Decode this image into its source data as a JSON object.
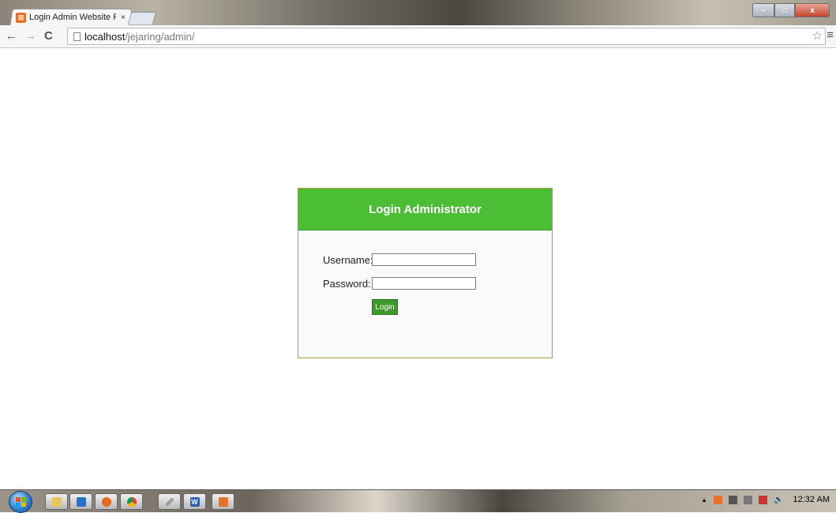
{
  "browser": {
    "tab_title": "Login Admin Website Pert",
    "tab_close": "×",
    "url_host": "localhost",
    "url_path": "/jejaring/admin/",
    "back_symbol": "←",
    "forward_symbol": "→",
    "reload_symbol": "C",
    "star_symbol": "☆",
    "menu_symbol": "≡",
    "win_min": "–",
    "win_max": "□",
    "win_close": "x"
  },
  "login": {
    "title": "Login Administrator",
    "username_label": "Username:",
    "password_label": "Password:",
    "username_value": "",
    "password_value": "",
    "button_label": "Login"
  },
  "taskbar": {
    "pinned": [
      "explorer-icon",
      "media-player-icon",
      "firefox-icon",
      "chrome-icon",
      "tool-icon",
      "word-icon",
      "xampp-icon"
    ],
    "clock": "12:32 AM",
    "tray_arrow": "▲",
    "volume_symbol": "🔈"
  },
  "colors": {
    "header_green": "#4cbe35",
    "button_green": "#3f9a2d",
    "box_border": "#b2993d"
  }
}
